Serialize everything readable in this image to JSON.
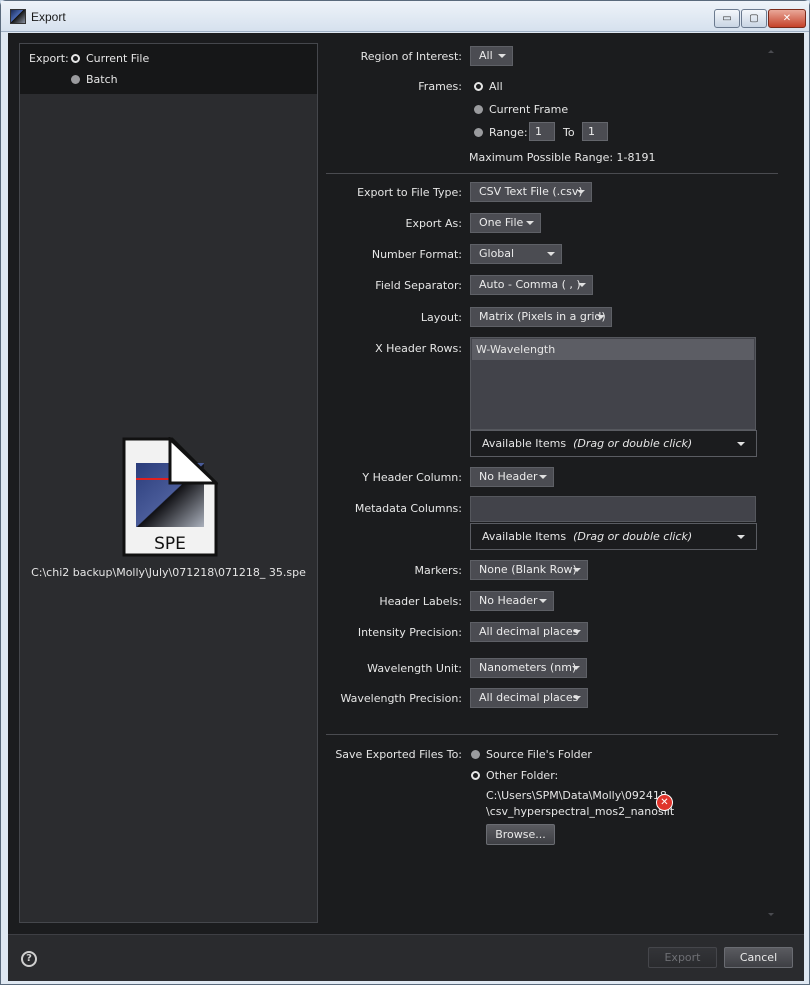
{
  "window": {
    "title": "Export",
    "controls": {
      "minimize": "▭",
      "maximize": "▢",
      "close": "✕"
    }
  },
  "left": {
    "export_label": "Export:",
    "option_current": "Current File",
    "option_batch": "Batch",
    "selected": "Current File",
    "file_icon_text": "SPE",
    "file_path": "C:\\chi2 backup\\Molly\\July\\071218\\071218_ 35.spe"
  },
  "form": {
    "roi_label": "Region of Interest:",
    "roi_value": "All",
    "frames_label": "Frames:",
    "frames_all": "All",
    "frames_current": "Current Frame",
    "frames_range": "Range:",
    "range_from": "1",
    "range_to_label": "To",
    "range_to": "1",
    "max_range": "Maximum Possible Range: 1-8191",
    "file_type_label": "Export to File Type:",
    "file_type_value": "CSV Text File (.csv)",
    "export_as_label": "Export As:",
    "export_as_value": "One File",
    "number_format_label": "Number Format:",
    "number_format_value": "Global",
    "field_sep_label": "Field Separator:",
    "field_sep_value": "Auto - Comma ( , )",
    "layout_label": "Layout:",
    "layout_value": "Matrix (Pixels in a grid)",
    "x_header_label": "X Header Rows:",
    "x_header_items": [
      "W-Wavelength"
    ],
    "available_items": "Available Items",
    "available_hint": "(Drag or double click)",
    "y_header_label": "Y Header Column:",
    "y_header_value": "No Header",
    "metadata_label": "Metadata Columns:",
    "markers_label": "Markers:",
    "markers_value": "None (Blank Row)",
    "header_labels_label": "Header Labels:",
    "header_labels_value": "No Header",
    "intensity_prec_label": "Intensity Precision:",
    "intensity_prec_value": "All decimal places",
    "wl_unit_label": "Wavelength Unit:",
    "wl_unit_value": "Nanometers (nm)",
    "wl_prec_label": "Wavelength Precision:",
    "wl_prec_value": "All decimal places",
    "save_to_label": "Save Exported Files To:",
    "save_source": "Source File's Folder",
    "save_other": "Other Folder:",
    "folder_line1": "C:\\Users\\SPM\\Data\\Molly\\092418",
    "folder_line2": "\\csv_hyperspectral_mos2_nanoslit",
    "browse": "Browse..."
  },
  "footer": {
    "help_icon": "?",
    "export_button": "Export",
    "cancel_button": "Cancel"
  },
  "colors": {
    "background": "#1b1c1e",
    "panel": "#2b2c2f",
    "control": "#4b4c52",
    "error": "#e0342c"
  }
}
